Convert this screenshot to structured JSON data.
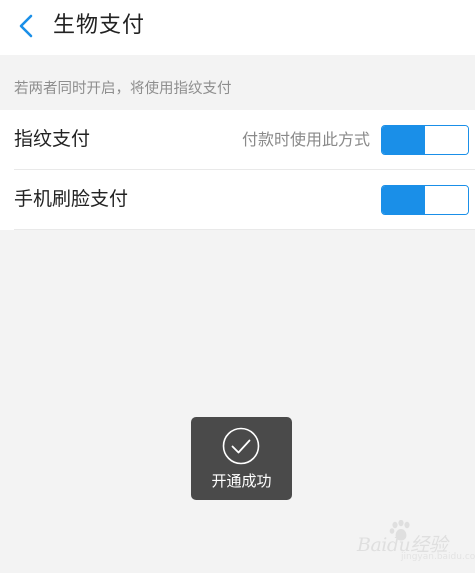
{
  "header": {
    "title": "生物支付",
    "back_icon": "chevron-left-icon"
  },
  "hint": {
    "text": "若两者同时开启，将使用指纹支付"
  },
  "settings": [
    {
      "label": "指纹支付",
      "description": "付款时使用此方式",
      "enabled": true
    },
    {
      "label": "手机刷脸支付",
      "description": "",
      "enabled": true
    }
  ],
  "toast": {
    "icon": "check-circle-icon",
    "text": "开通成功"
  },
  "watermark": {
    "text": "Baidu经验",
    "sub": "jingyan.baidu.com"
  },
  "colors": {
    "accent": "#1a8fe8",
    "background": "#f3f3f3",
    "toast_bg": "#3c3c3c"
  }
}
